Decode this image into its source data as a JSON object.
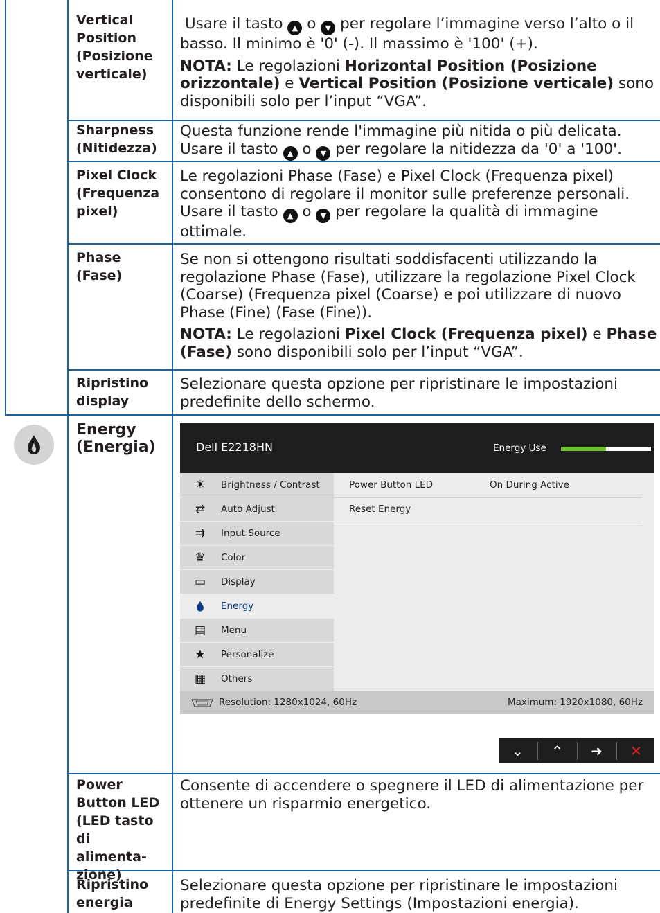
{
  "rows": [
    {
      "label": "Vertical Position (Posizione verticale)",
      "lines": [
        "Usare il tasto",
        "o",
        "per regolare l’immagine verso l’alto o il",
        "basso. Il minimo è '0' (-). Il massimo è '100' (+)."
      ],
      "note": {
        "prefix": "NOTA:",
        "line1_a": "Le regolazioni",
        "line1_b": "Horizontal Position (Posizione",
        "line2_a": "orizzontale)",
        "line2_b": "e",
        "line2_c": "Vertical Position (Posizione verticale)",
        "line2_d": "sono",
        "line3": "disponibili solo per l’input “VGA”."
      }
    },
    {
      "label": "Sharpness (Nitidezza)",
      "line1": "Questa funzione rende l'immagine più nitida o più delicata.",
      "line2_a": "Usare il tasto",
      "line2_b": "o",
      "line2_c": "per regolare la nitidezza da '0' a '100'."
    },
    {
      "label": "Pixel Clock (Frequenza pixel)",
      "line1": "Le regolazioni Phase (Fase) e Pixel Clock (Frequenza pixel)",
      "line2": "consentono di regolare il monitor sulle preferenze personali.",
      "line3_a": "Usare il tasto",
      "line3_b": "o",
      "line3_c": "per regolare la qualità di immagine",
      "line4": "ottimale."
    },
    {
      "label": "Phase (Fase)",
      "line1": "Se non si ottengono risultati soddisfacenti utilizzando la",
      "line2": "regolazione Phase (Fase), utilizzare la regolazione Pixel Clock",
      "line3": "(Coarse) (Frequenza pixel (Coarse) e poi utilizzare di nuovo",
      "line4": "Phase (Fine) (Fase (Fine)).",
      "note": {
        "prefix": "NOTA:",
        "a": "Le regolazioni",
        "b": "Pixel Clock (Frequenza pixel)",
        "c": "e",
        "d": "Phase",
        "e": "(Fase)",
        "f": "sono disponibili solo per l’input “VGA”."
      }
    },
    {
      "label": "Ripristino display",
      "line1": "Selezionare questa opzione per ripristinare le impostazioni",
      "line2": "predefinite dello schermo."
    },
    {
      "label": "Energy (Energia)"
    },
    {
      "label": "Power Button LED (LED tasto di alimenta-zione)",
      "line1": "Consente di accendere o spegnere il LED di alimentazione per",
      "line2": "ottenere un risparmio energetico."
    },
    {
      "label": "Ripristino energia",
      "line1": "Selezionare questa opzione per ripristinare le impostazioni",
      "line2": "predefinite di Energy Settings (Impostazioni energia)."
    }
  ],
  "arrow_icons": [
    "up-arrow-icon",
    "down-arrow-icon"
  ],
  "osd": {
    "title": "Dell E2218HN",
    "energy_use_label": "Energy Use",
    "energy_use_level": 0.5,
    "menu": [
      {
        "label": "Brightness / Contrast",
        "icon": "brightness-icon"
      },
      {
        "label": "Auto Adjust",
        "icon": "auto-adjust-icon"
      },
      {
        "label": "Input Source",
        "icon": "input-source-icon"
      },
      {
        "label": "Color",
        "icon": "color-icon"
      },
      {
        "label": "Display",
        "icon": "display-icon"
      },
      {
        "label": "Energy",
        "icon": "energy-icon",
        "active": true
      },
      {
        "label": "Menu",
        "icon": "menu-icon"
      },
      {
        "label": "Personalize",
        "icon": "star-icon"
      },
      {
        "label": "Others",
        "icon": "others-icon"
      }
    ],
    "settings": [
      {
        "name": "Power Button LED",
        "value": "On During Active"
      },
      {
        "name": "Reset Energy",
        "value": ""
      }
    ],
    "resolution": "Resolution: 1280x1024, 60Hz",
    "maximum": "Maximum: 1920x1080, 60Hz",
    "buttons": [
      "down-arrow-icon",
      "up-arrow-icon",
      "right-arrow-icon",
      "close-icon"
    ],
    "active_color": "#0b3c87",
    "meter_color": "#6dc02e",
    "exit_color": "#e02020"
  }
}
